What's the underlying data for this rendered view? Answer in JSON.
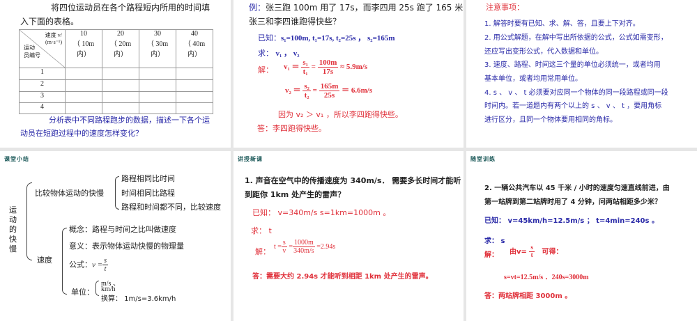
{
  "s1": {
    "title1": "将四位运动员在各个路程短内所用的时间填",
    "title2": "入下面的表格。",
    "hdr_speed": "速度 v/",
    "hdr_unit": "(m·s⁻¹)",
    "hdr_row": "运动",
    "hdr_row2": "员编号",
    "cols": [
      [
        "10",
        "（ 10m",
        "内）"
      ],
      [
        "20",
        "（ 20m",
        "内）"
      ],
      [
        "30",
        "（ 30m",
        "内）"
      ],
      [
        "40",
        "（ 40m",
        "内）"
      ]
    ],
    "rows": [
      "1",
      "2",
      "3",
      "4"
    ],
    "q1": "分析表中不同路程跑步的数据，描述一下各个运",
    "q2": "动员在短跑过程中的速度怎样变化？"
  },
  "s2": {
    "ex_label": "例：",
    "ex1": "张三跑 100m 用了 17s，而李四用 25s 跑了 165 米，",
    "ex2": "张三和李四谁跑得快些？",
    "known_label": "已知：",
    "known": "s₁=100m, t₁=17s, t₂=25s ，  s₂=165m",
    "find_label": "求：",
    "find": "v₁ ， v₂",
    "sol_label": "解：",
    "v1": "v₁ ＝",
    "s1n": "s₁",
    "t1d": "t₁",
    "n1": "100m",
    "d1": "17s",
    "r1": "≈ 5.9m/s",
    "v2": "v₂ ＝",
    "s2n": "s₂",
    "t2d": "t₂",
    "n2": "165m",
    "d2": "25s",
    "r2": "＝ 6.6m/s",
    "because": "因为 v₂ ＞ v₁ ，所以李四跑得快些。",
    "answer": "答：李四跑得快些。"
  },
  "s3": {
    "title": "注意事项：",
    "lines": [
      "1. 解答时要有已知、求、解、答，且要上下对齐。",
      "2. 用公式解题，在解中写出所依据的公式，公式如需变形，",
      "还应写出变形公式，代入数据和单位。",
      "3. 速度、路程、时间这三个量的单位必须统一，或者均用",
      "基本单位，或者均用常用单位。",
      "4. s 、 v 、 t 必须要对应同一个物体的同一段路程或同一段",
      "时间内。若一道题内有两个以上的 s 、 v 、 t ，要用角标",
      "进行区分，且同一个物体要用相同的角标。"
    ]
  },
  "s4": {
    "tag": "课堂小结",
    "root": "运动的快慢",
    "compare": "比较物体运动的快慢",
    "c_items": [
      "路程相同比时间",
      "时间相同比路程",
      "路程和时间都不同，比较速度"
    ],
    "speed": "速度",
    "concept": "概念：路程与时间之比叫做速度",
    "meaning": "意义：表示物体运动快慢的物理量",
    "formula_label": "公式：",
    "formula_v": "v =",
    "formula_n": "s",
    "formula_d": "t",
    "unit_label": "单位：",
    "unit1": "m/s 、",
    "unit2": "km/h",
    "convert": "换算：  1m/s=3.6km/h"
  },
  "s5": {
    "tag": "讲授新课",
    "q1": "1. 声音在空气中的传播速度为 340m/s． 需要多长时间才能听",
    "q2": "到距你 1km 处产生的雷声？",
    "known": "已知： v=340m/s  s=1km=1000m 。",
    "find": "求： t",
    "sol_label": "解：",
    "t_eq": "t =",
    "sn": "s",
    "vd": "v",
    "n": "1000m",
    "d": "340m/s",
    "res": "=2.94s",
    "answer": "答：需要大约 2.94s 才能听到相距 1km 处产生的雷声。"
  },
  "s6": {
    "tag": "随堂训练",
    "q1": "2. 一辆公共汽车以 45 千米 / 小时的速度匀速直线前进，由",
    "q2": "第一站牌到第二站牌时用了 4 分钟，问两站相距多少米？",
    "known": "已知： v=45km/h=12.5m/s ； t=4min=240s 。",
    "find": "求： s",
    "sol_label": "解：",
    "by": "由v=",
    "sn": "s",
    "td": "t",
    "get": "可得：",
    "calc": "s=vt=12.5m/s ．240s=3000m",
    "answer": "答：两站牌相距 3000m 。"
  }
}
